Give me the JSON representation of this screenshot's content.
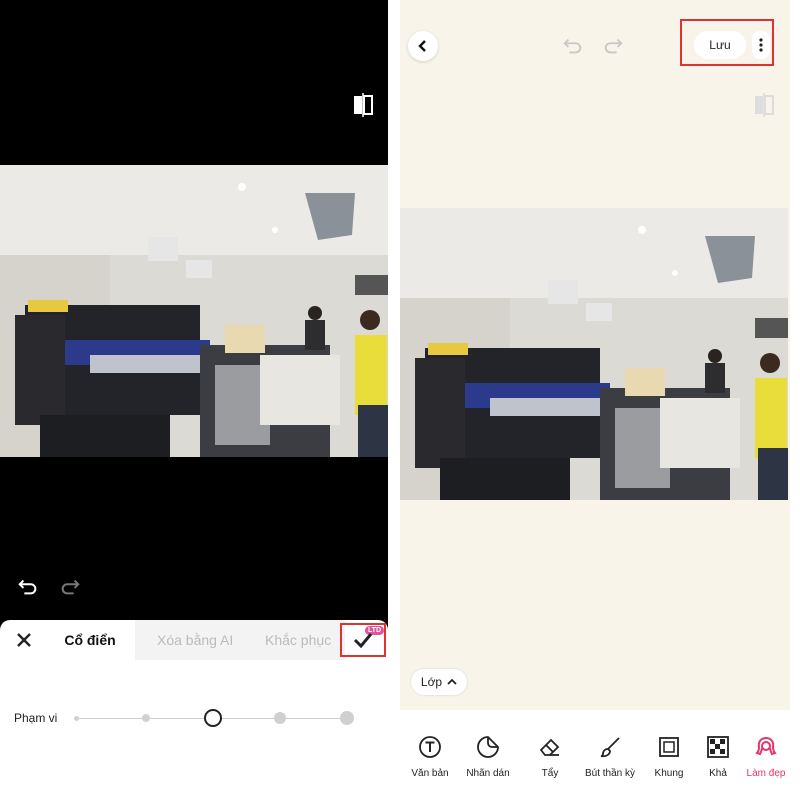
{
  "left_panel": {
    "tabs": [
      "Cổ điển",
      "Xóa bằng AI",
      "Khắc phục"
    ],
    "badge": "LTD",
    "slider_label": "Phạm vi",
    "slider_level": 0.5
  },
  "right_panel": {
    "save_label": "Lưu",
    "layer_label": "Lớp",
    "tools": [
      {
        "label": "Văn bản",
        "icon": "text-icon"
      },
      {
        "label": "Nhãn dán",
        "icon": "sticker-icon"
      },
      {
        "label": "Tẩy",
        "icon": "eraser-icon"
      },
      {
        "label": "Bút thần kỳ",
        "icon": "brush-icon"
      },
      {
        "label": "Khung",
        "icon": "frame-icon"
      },
      {
        "label": "Khả",
        "icon": "mosaic-icon"
      },
      {
        "label": "Làm đẹp",
        "icon": "beauty-icon"
      }
    ]
  },
  "colors": {
    "accent_red": "#dd3333",
    "beauty_pink": "#e5356b",
    "cream_bg": "#f8f4ea"
  }
}
